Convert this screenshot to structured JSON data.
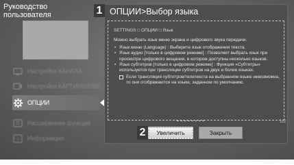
{
  "sidebar": {
    "title": "Руководство\nпользователя",
    "items": [
      {
        "label": "Настройка КАНАЛА",
        "icon": "tv-channel-icon"
      },
      {
        "label": "Настройка КАРТИНКИ/ЗВУКА",
        "icon": "picture-sound-icon"
      },
      {
        "label": "ОПЦИИ",
        "icon": "gear-icon"
      },
      {
        "label": "Расширенная функция",
        "icon": "advanced-function-icon"
      },
      {
        "label": "Информация",
        "icon": "info-icon"
      }
    ]
  },
  "callouts": {
    "panel": "1",
    "zoom": "2"
  },
  "panel": {
    "title": "ОПЦИИ>Выбор языка",
    "path": "SETTINGS □ ОПЦИИ □ Язык",
    "intro": "Можно выбрать язык меню экрана и цифрового звука передачи.",
    "bullets": [
      "Язык меню (Language) : Выберите язык отображения текста.",
      "Язык аудио [только в цифровом режиме] : Позволяет выбрать язык при просмотре цифрового вещания, в котором доступны несколько языков.",
      "Язык субтитров [только в цифровом режиме] : Функция «Субтитры» используется при трансляции субтитров на двух и более языках."
    ],
    "note": "Если трансляция субтитров/телетекста на выбранном языке невозможна, то они отображаются на языке, заданном по умолчанию.",
    "page": "1/2",
    "zoom_button": "Увеличить",
    "close_button": "Закрыть"
  }
}
